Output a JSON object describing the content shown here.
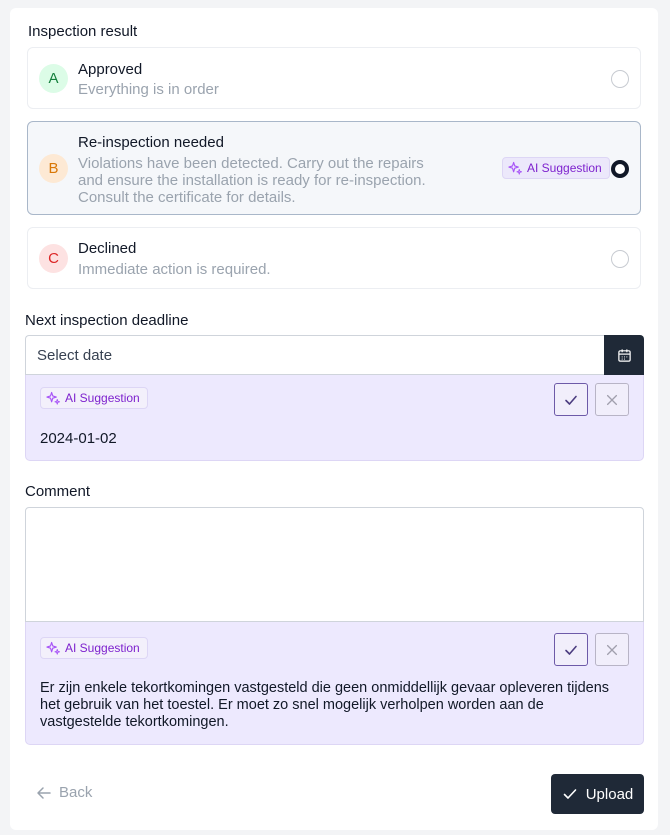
{
  "inspection": {
    "title": "Inspection result",
    "options": [
      {
        "badge": "A",
        "title": "Approved",
        "description": "Everything is in order"
      },
      {
        "badge": "B",
        "title": "Re-inspection needed",
        "description_lines": [
          "Violations have been detected. Carry out the repairs",
          "and ensure the installation is ready for re-inspection.",
          "Consult the certificate for details."
        ],
        "ai_tag": "AI Suggestion"
      },
      {
        "badge": "C",
        "title": "Declined",
        "description": "Immediate action is required."
      }
    ]
  },
  "deadline": {
    "title": "Next inspection deadline",
    "placeholder": "Select date",
    "suggestion_label": "AI Suggestion",
    "suggestion_value": "2024-01-02"
  },
  "comment": {
    "title": "Comment",
    "value": "",
    "suggestion_label": "AI Suggestion",
    "suggestion_lines": [
      "Er zijn enkele tekortkomingen vastgesteld die geen onmiddellijk gevaar opleveren tijdens",
      "het gebruik van het toestel. Er moet zo snel mogelijk verholpen worden aan de",
      "vastgestelde tekortkomingen."
    ]
  },
  "footer": {
    "back_label": "Back",
    "upload_label": "Upload"
  },
  "colors": {
    "primary": "#1f2937",
    "ai_accent": "#7e22ce",
    "suggestion_bg": "#ede9fe"
  }
}
